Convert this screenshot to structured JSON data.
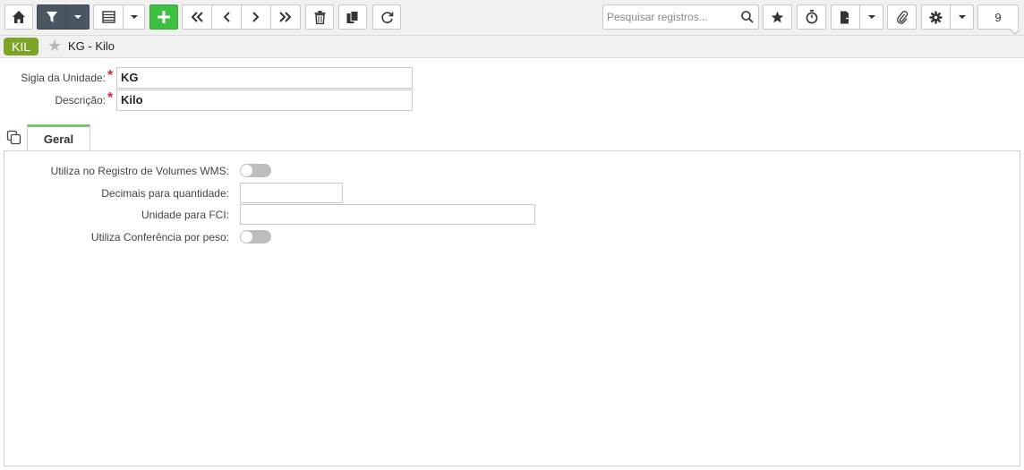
{
  "toolbar": {
    "search_placeholder": "Pesquisar registros...",
    "record_count": "9"
  },
  "titlebar": {
    "badge": "KIL",
    "title": "KG - Kilo"
  },
  "form": {
    "sigla_label": "Sigla da Unidade:",
    "sigla_value": "KG",
    "descricao_label": "Descrição:",
    "descricao_value": "Kilo",
    "required_marker": "*"
  },
  "tabs": [
    {
      "label": "Geral",
      "active": true
    }
  ],
  "geral": {
    "wms_label": "Utiliza no Registro de Volumes WMS:",
    "wms_enabled": false,
    "decimais_label": "Decimais para quantidade:",
    "decimais_value": "",
    "fci_label": "Unidade para FCI:",
    "fci_value": "",
    "peso_label": "Utiliza Conferência por peso:",
    "peso_enabled": false
  },
  "colors": {
    "badge_green": "#7ba428",
    "add_green": "#3fbf3f",
    "filter_dark": "#4a5763",
    "tab_accent": "#7bc86c",
    "required_red": "#d9262c"
  }
}
